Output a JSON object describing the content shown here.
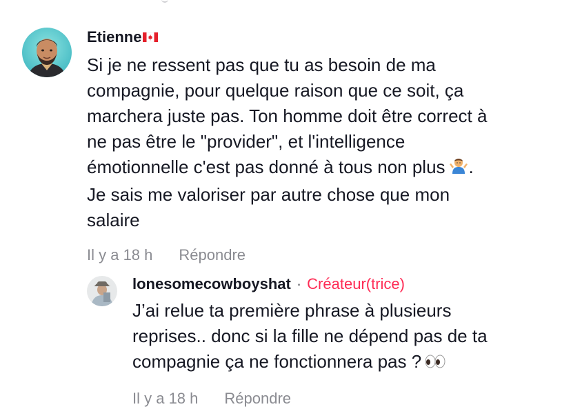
{
  "comments": [
    {
      "username": "Etienne",
      "text_lines": [
        "Si je ne ressent pas que tu as besoin de ma",
        "compagnie, pour quelque raison que ce soit, ça",
        "marchera juste pas. Ton homme doit être correct à",
        "ne pas être le \"provider\", et l'intelligence",
        "émotionnelle c'est pas donné à tous non plus",
        "Je sais me valoriser par autre chose que mon",
        "salaire"
      ],
      "line5_suffix": ".",
      "time": "Il y a 18 h",
      "reply_label": "Répondre",
      "emoji": "man-shrugging-icon"
    }
  ],
  "reply": {
    "username": "lonesomecowboyshat",
    "separator": "·",
    "badge": "Créateur(trice)",
    "text_lines": [
      "J’ai relue ta première phrase à plusieurs",
      "reprises.. donc si la fille ne dépend pas de ta",
      "compagnie ça ne fonctionnera pas ?"
    ],
    "time": "Il y a 18 h",
    "reply_label": "Répondre",
    "emoji": "eyes-icon"
  },
  "colors": {
    "badge": "#fe2c55",
    "meta": "#8a8b91",
    "text": "#161823"
  }
}
